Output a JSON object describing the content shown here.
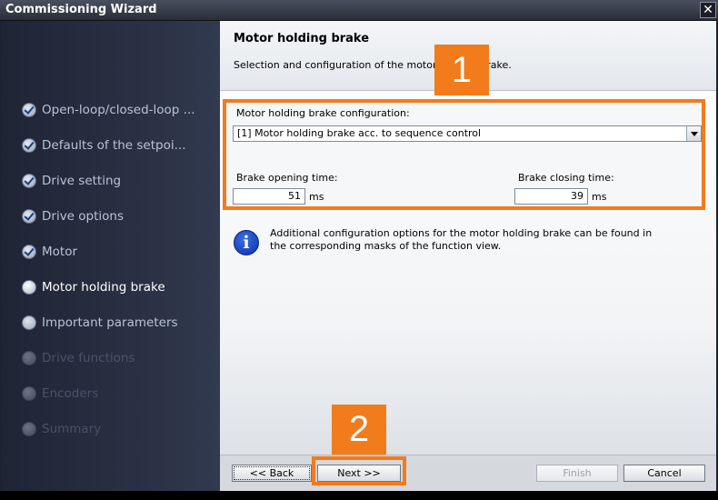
{
  "window": {
    "title": "Commissioning Wizard",
    "close_glyph": "✕"
  },
  "sidebar": {
    "steps": [
      {
        "label": "Open-loop/closed-loop ...",
        "state": "done"
      },
      {
        "label": "Defaults of the setpoi...",
        "state": "done"
      },
      {
        "label": "Drive setting",
        "state": "done"
      },
      {
        "label": "Drive options",
        "state": "done"
      },
      {
        "label": "Motor",
        "state": "done"
      },
      {
        "label": "Motor holding brake",
        "state": "current"
      },
      {
        "label": "Important parameters",
        "state": "next"
      },
      {
        "label": "Drive functions",
        "state": "disabled"
      },
      {
        "label": "Encoders",
        "state": "disabled"
      },
      {
        "label": "Summary",
        "state": "disabled"
      }
    ]
  },
  "page": {
    "title": "Motor holding brake",
    "description": "Selection and configuration of the motor holding brake."
  },
  "config": {
    "label": "Motor holding brake configuration:",
    "selected": "[1] Motor holding brake acc. to sequence control",
    "opening_label": "Brake opening time:",
    "opening_value": "51",
    "opening_unit": "ms",
    "closing_label": "Brake closing time:",
    "closing_value": "39",
    "closing_unit": "ms"
  },
  "info": {
    "icon": "i",
    "text": "Additional configuration options for the motor holding brake can be found in the corresponding masks of the function view."
  },
  "callouts": {
    "one": "1",
    "two": "2"
  },
  "footer": {
    "back": "<< Back",
    "next": "Next >>",
    "finish": "Finish",
    "cancel": "Cancel"
  },
  "colors": {
    "highlight": "#f27b1c",
    "info_icon": "#0a2fa8"
  }
}
